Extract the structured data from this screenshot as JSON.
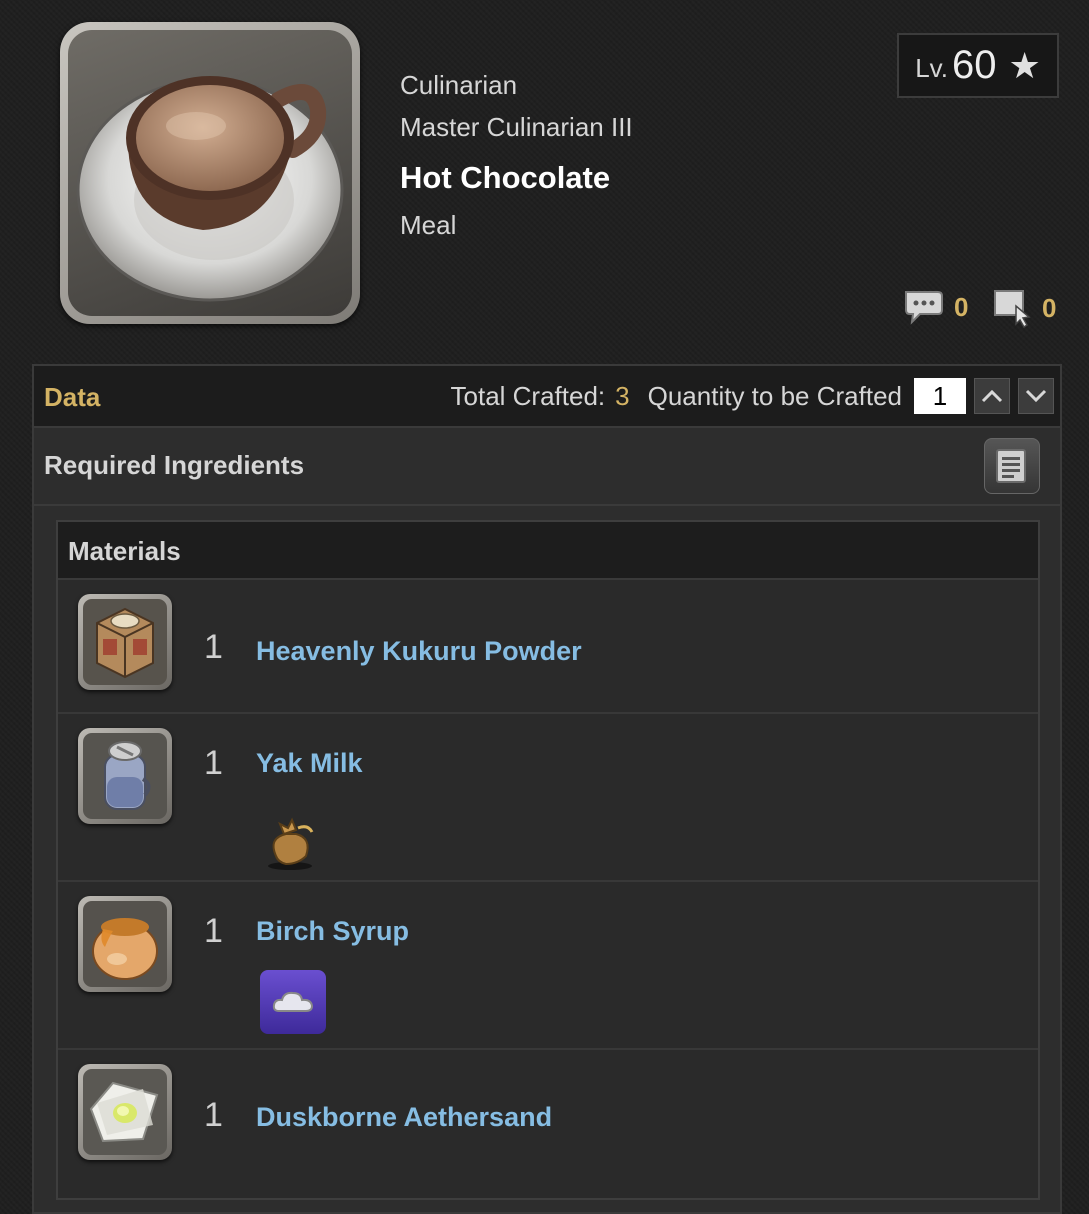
{
  "item": {
    "icon": "hot-chocolate-icon",
    "category": "Culinarian",
    "recipe_book": "Master Culinarian III",
    "name": "Hot Chocolate",
    "type": "Meal",
    "level_prefix": "Lv.",
    "level": "60",
    "star_icon": "star-icon"
  },
  "counters": {
    "comments": "0",
    "comment_icon": "comment-bubble-icon",
    "gathering_logs": "0",
    "log_icon": "pointer-note-icon"
  },
  "data_bar": {
    "label": "Data",
    "total_crafted_label": "Total Crafted:",
    "total_crafted_value": "3",
    "quantity_label": "Quantity to be Crafted",
    "quantity_value": "1"
  },
  "ingredients": {
    "label": "Required Ingredients",
    "list_icon": "document-list-icon"
  },
  "materials": {
    "header": "Materials",
    "items": [
      {
        "qty": "1",
        "name": "Heavenly Kukuru Powder",
        "icon": "powder-crate-icon",
        "sub_icon": null
      },
      {
        "qty": "1",
        "name": "Yak Milk",
        "icon": "milk-jar-icon",
        "sub_icon": "gil-pouch-icon"
      },
      {
        "qty": "1",
        "name": "Birch Syrup",
        "icon": "syrup-pot-icon",
        "sub_icon": "cloud-icon"
      },
      {
        "qty": "1",
        "name": "Duskborne Aethersand",
        "icon": "aethersand-icon",
        "sub_icon": null
      }
    ]
  },
  "colors": {
    "accent_gold": "#d4b364",
    "link_blue": "#86bde3",
    "background": "#1f1f1f"
  }
}
